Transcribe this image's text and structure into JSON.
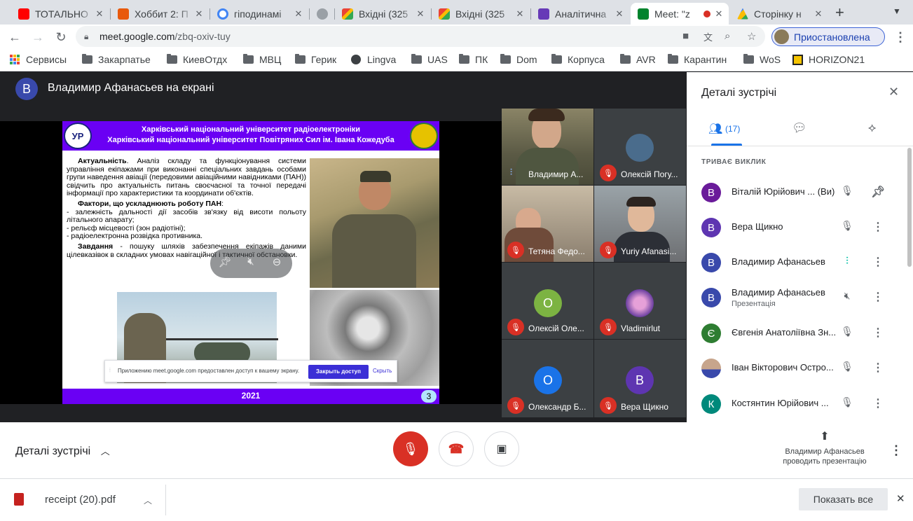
{
  "tabs": [
    {
      "title": "ТОТАЛЬНО",
      "color": "#ff0000"
    },
    {
      "title": "Хоббит 2: П",
      "color": "#e8590c"
    },
    {
      "title": "гіподинамі",
      "color": "#4285f4"
    },
    {
      "title": "",
      "color": "#9aa0a6"
    },
    {
      "title": "Вхідні (325",
      "color": "#d93025"
    },
    {
      "title": "Вхідні (325",
      "color": "#d93025"
    },
    {
      "title": "Аналітична",
      "color": "#673ab7"
    },
    {
      "title": "Meet: \"z",
      "color": "#00832d"
    },
    {
      "title": "Сторінку н",
      "color": "#34a853"
    }
  ],
  "toolbar": {
    "url_host": "meet.google.com",
    "url_path": "/zbq-oxiv-tuy",
    "profile_label": "Приостановлена"
  },
  "bookmarks": [
    "Сервисы",
    "Закарпатье",
    "КиевОтдх",
    "МВЦ",
    "Герик",
    "Lingva",
    "UAS",
    "ПК",
    "Dom",
    "Корпуса",
    "AVR",
    "Карантин",
    "WoS",
    "HORIZON21"
  ],
  "meet": {
    "presenter_initial": "В",
    "presenter_title": "Владимир Афанасьев на екрані",
    "slide": {
      "header1": "Харківський національний університет радіоелектроніки",
      "header2": "Харківський національний університет Повітряних Сил ім. Івана Кожедуба",
      "p1_title": "Актуальність",
      "p1_text": ". Аналіз складу та функціонування системи управління екіпажами при виконанні спеціальних завдань особами групи наведення авіації (передовими авіаційними навідниками (ПАН)) свідчить про актуальність питань своєчасної та точної передачі інформації про характеристики та координати об'єктів.",
      "p2_title": "Фактори, що ускладнюють роботу ПАН",
      "bullets": [
        "- залежність дальності дії засобів зв'язку від висоти польоту літального апарату;",
        "- рельєф місцевості (зон радіотіні);",
        "- радіоелектронна розвідка противника."
      ],
      "p3_title": "Завдання",
      "p3_text": " - пошуку шляхів забезпечення екіпажів даними цілевказівок в складних умовах навігаційної і тактичної обстановки.",
      "share_notice": "Приложению meet.google.com предоставлен доступ к вашему экрану.",
      "share_stop": "Закрыть доступ",
      "share_hide": "Скрыть",
      "footer_year": "2021",
      "page_num": "3"
    },
    "tiles": [
      {
        "name": "Владимир А...",
        "type": "video",
        "bg": "#5b5a45"
      },
      {
        "name": "Олексій Погу...",
        "type": "avatar",
        "bg": "#4a6c8c",
        "initial": ""
      },
      {
        "name": "Тетяна Федо...",
        "type": "video",
        "bg": "#8a7e6e"
      },
      {
        "name": "Yuriy Afanasi...",
        "type": "video",
        "bg": "#6d6f72"
      },
      {
        "name": "Олексій Оле...",
        "type": "avatar",
        "bg": "#1e8e3e",
        "initial": "О"
      },
      {
        "name": "Vladimirlut",
        "type": "avatar",
        "bg": "#6b3fa0",
        "initial": ""
      },
      {
        "name": "Олександр Б...",
        "type": "avatar",
        "bg": "#1a73e8",
        "initial": "О"
      },
      {
        "name": "Вера Щикно",
        "type": "avatar",
        "bg": "#5e35b1",
        "initial": "В"
      }
    ]
  },
  "panel": {
    "title": "Деталі зустрічі",
    "people_count": "(17)",
    "section_label": "ТРИВАЄ ВИКЛИК",
    "participants": [
      {
        "name": "Віталій Юрійович ...",
        "suffix": "(Ви)",
        "initial": "В",
        "color": "#6a1b9a",
        "sub": ""
      },
      {
        "name": "Вера Щикно",
        "suffix": "",
        "initial": "В",
        "color": "#5e35b1",
        "sub": ""
      },
      {
        "name": "Владимир Афанасьев",
        "suffix": "",
        "initial": "В",
        "color": "#3949ab",
        "sub": ""
      },
      {
        "name": "Владимир Афанасьев",
        "suffix": "",
        "initial": "В",
        "color": "#3949ab",
        "sub": "Презентація"
      },
      {
        "name": "Євгенія Анатоліївна Зн...",
        "suffix": "",
        "initial": "Є",
        "color": "#2e7d32",
        "sub": ""
      },
      {
        "name": "Іван Вікторович Остро...",
        "suffix": "",
        "initial": "",
        "color": "#8d6e63",
        "sub": ""
      },
      {
        "name": "Костянтин Юрійович ...",
        "suffix": "",
        "initial": "К",
        "color": "#00897b",
        "sub": ""
      }
    ]
  },
  "bottom": {
    "details_label": "Деталі зустрічі",
    "presenting_line1": "Владимир Афанасьев",
    "presenting_line2": "проводить презентацію"
  },
  "shelf": {
    "file_name": "receipt (20).pdf",
    "show_all": "Показать все"
  }
}
